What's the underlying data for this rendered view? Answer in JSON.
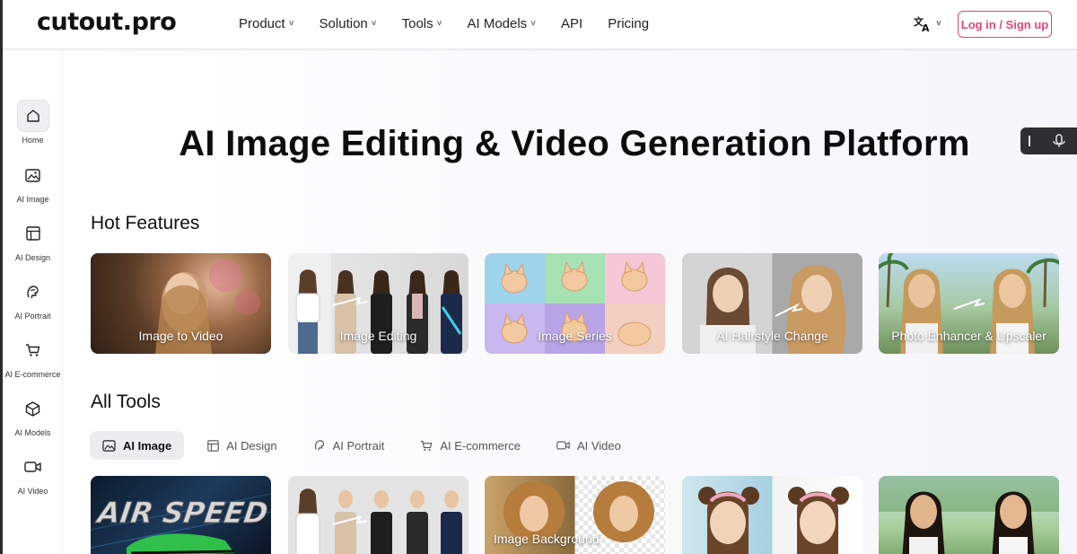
{
  "header": {
    "logo": "cutout.pro",
    "nav": [
      {
        "label": "Product",
        "chevron": "˅"
      },
      {
        "label": "Solution",
        "chevron": "˅"
      },
      {
        "label": "Tools",
        "chevron": "˅"
      },
      {
        "label": "AI Models",
        "chevron": "˅"
      },
      {
        "label": "API",
        "chevron": ""
      },
      {
        "label": "Pricing",
        "chevron": ""
      }
    ],
    "language_icon": "translate-icon",
    "language_chevron": "˅",
    "login_label": "Log in / Sign up",
    "accent_color": "#e0467c"
  },
  "sidebar": {
    "items": [
      {
        "label": "Home",
        "icon": "home-icon",
        "active": true
      },
      {
        "label": "AI Image",
        "icon": "image-icon"
      },
      {
        "label": "AI Design",
        "icon": "layout-icon"
      },
      {
        "label": "AI Portrait",
        "icon": "portrait-icon"
      },
      {
        "label": "AI E-commerce",
        "icon": "cart-icon"
      },
      {
        "label": "AI Models",
        "icon": "cube-icon"
      },
      {
        "label": "AI Video",
        "icon": "video-icon"
      }
    ]
  },
  "hero": {
    "title": "AI Image Editing & Video Generation Platform"
  },
  "hot_features": {
    "title": "Hot Features",
    "cards": [
      {
        "label": "Image to Video"
      },
      {
        "label": "Image Editing"
      },
      {
        "label": "Image Series"
      },
      {
        "label": "AI Hairstyle Change"
      },
      {
        "label": "Photo Enhancer & Upscaler"
      }
    ]
  },
  "all_tools": {
    "title": "All Tools",
    "tabs": [
      {
        "label": "AI Image",
        "icon": "image-icon",
        "active": true
      },
      {
        "label": "AI Design",
        "icon": "layout-icon"
      },
      {
        "label": "AI Portrait",
        "icon": "portrait-icon"
      },
      {
        "label": "AI E-commerce",
        "icon": "cart-icon"
      },
      {
        "label": "AI Video",
        "icon": "video-icon"
      }
    ],
    "cards": [
      {
        "label": "",
        "overlay_text": "AIR SPEED"
      },
      {
        "label": ""
      },
      {
        "label": "Image Background"
      },
      {
        "label": ""
      },
      {
        "label": ""
      }
    ]
  },
  "voice_widget": {
    "icon": "microphone-icon"
  }
}
